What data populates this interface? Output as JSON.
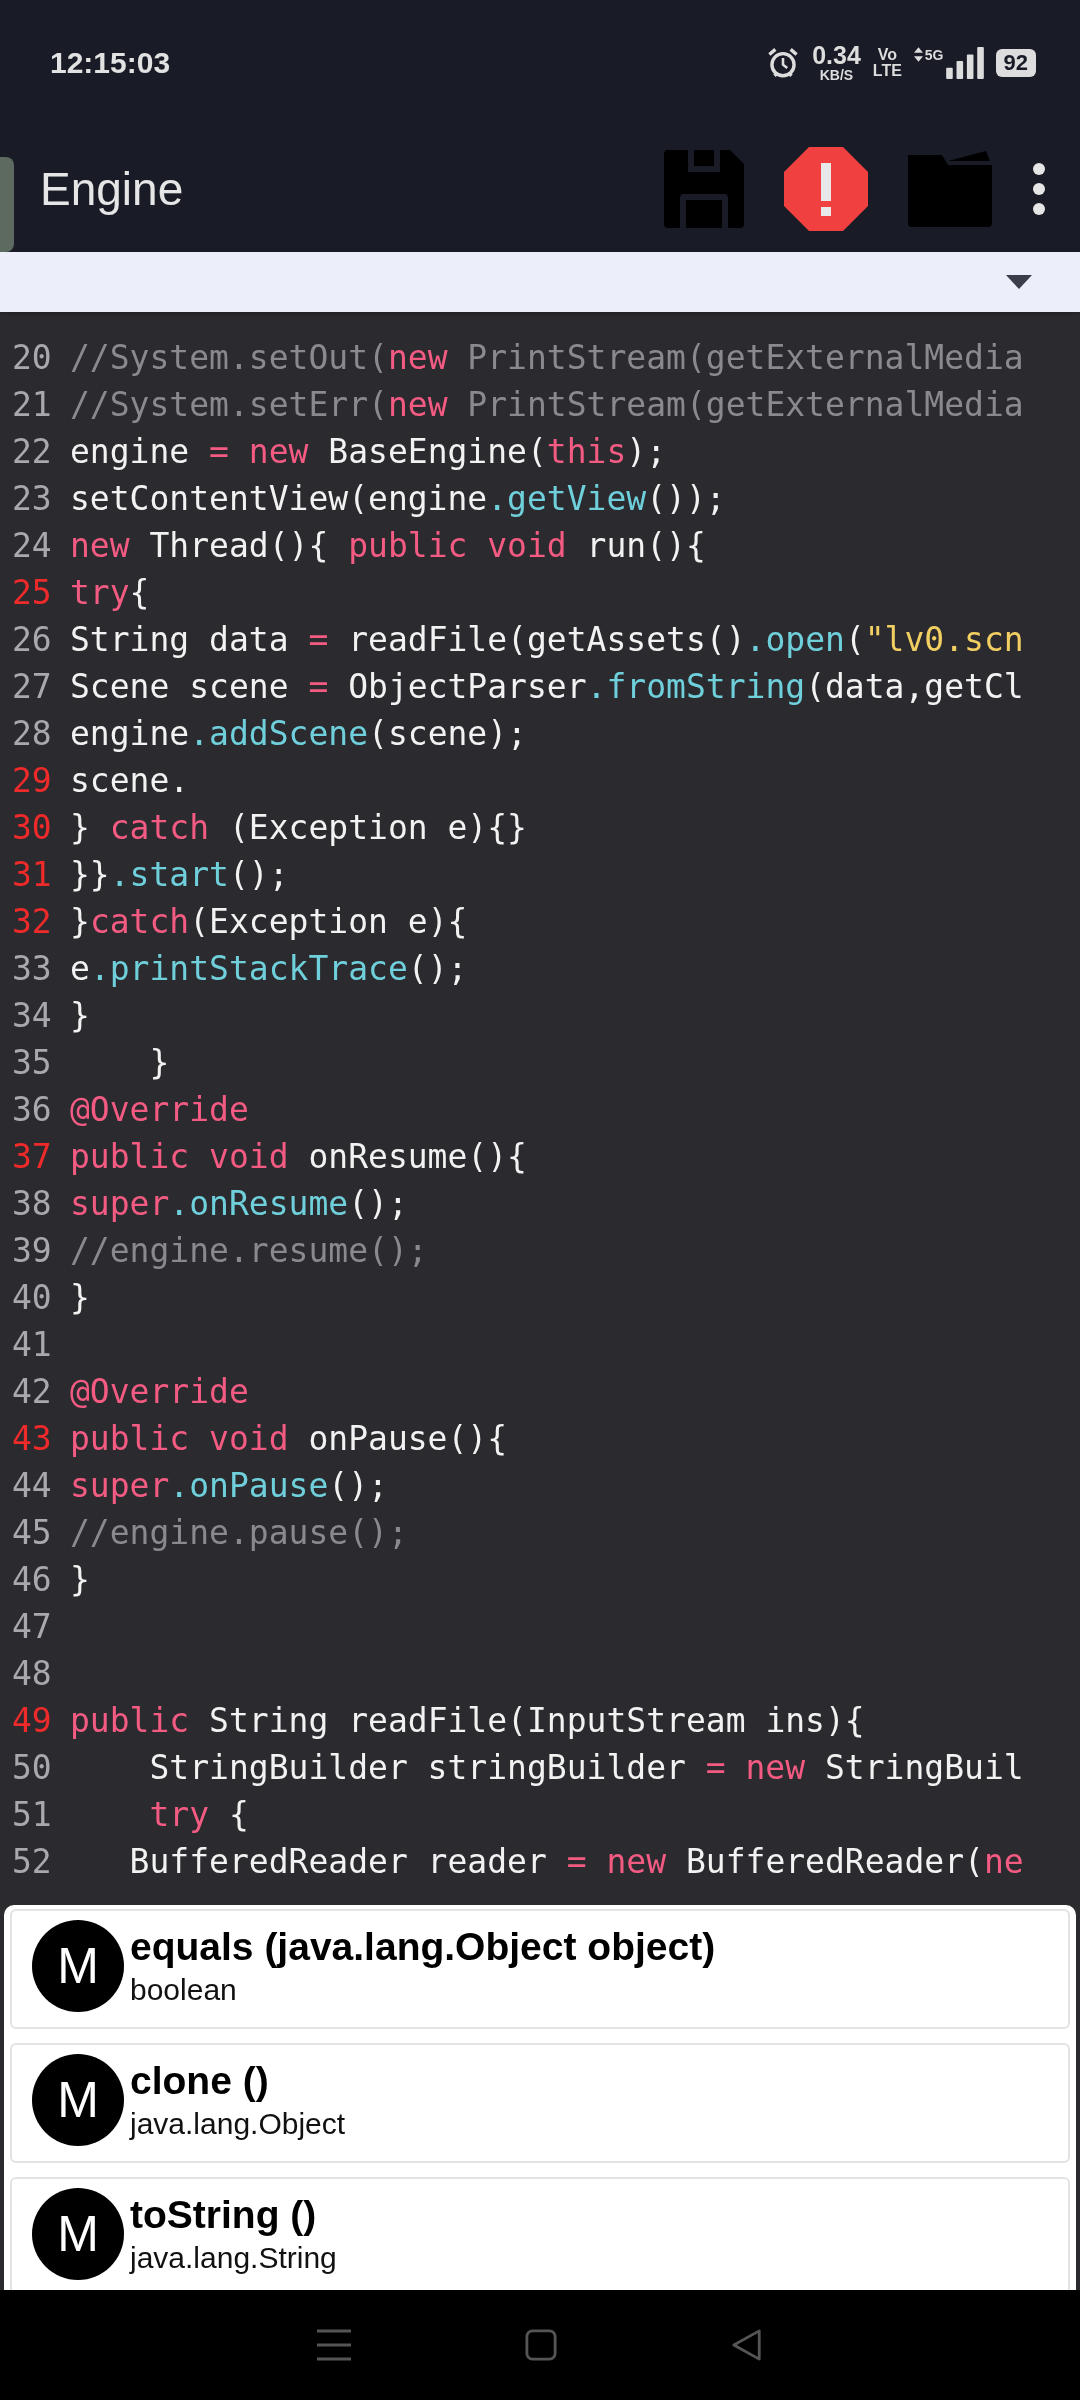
{
  "status_bar": {
    "time": "12:15:03",
    "speed": "0.34",
    "speed_unit": "KB/S",
    "volte_top": "Vo",
    "volte_bottom": "LTE",
    "network": "5G",
    "battery": "92"
  },
  "toolbar": {
    "title": "Engine"
  },
  "code": {
    "lines": [
      {
        "number": "20",
        "marked": false,
        "tokens": [
          {
            "kind": "comment",
            "text": "//System.setOut("
          },
          {
            "kind": "keyword",
            "text": "new"
          },
          {
            "kind": "comment",
            "text": " PrintStream(getExternalMedia"
          }
        ]
      },
      {
        "number": "21",
        "marked": false,
        "tokens": [
          {
            "kind": "comment",
            "text": "//System.setErr("
          },
          {
            "kind": "keyword",
            "text": "new"
          },
          {
            "kind": "comment",
            "text": " PrintStream(getExternalMedia"
          }
        ]
      },
      {
        "number": "22",
        "marked": false,
        "tokens": [
          {
            "kind": "plain",
            "text": "engine "
          },
          {
            "kind": "keyword",
            "text": "= new"
          },
          {
            "kind": "plain",
            "text": " BaseEngine("
          },
          {
            "kind": "keyword",
            "text": "this"
          },
          {
            "kind": "plain",
            "text": ");"
          }
        ]
      },
      {
        "number": "23",
        "marked": false,
        "tokens": [
          {
            "kind": "plain",
            "text": "setContentView(engine"
          },
          {
            "kind": "method",
            "text": ".getView"
          },
          {
            "kind": "plain",
            "text": "());"
          }
        ]
      },
      {
        "number": "24",
        "marked": false,
        "tokens": [
          {
            "kind": "keyword",
            "text": "new"
          },
          {
            "kind": "plain",
            "text": " Thread(){ "
          },
          {
            "kind": "keyword",
            "text": "public void"
          },
          {
            "kind": "plain",
            "text": " run(){"
          }
        ]
      },
      {
        "number": "25",
        "marked": true,
        "tokens": [
          {
            "kind": "keyword",
            "text": "try"
          },
          {
            "kind": "plain",
            "text": "{"
          }
        ]
      },
      {
        "number": "26",
        "marked": false,
        "tokens": [
          {
            "kind": "plain",
            "text": "String data "
          },
          {
            "kind": "keyword",
            "text": "="
          },
          {
            "kind": "plain",
            "text": " readFile(getAssets()"
          },
          {
            "kind": "method",
            "text": ".open"
          },
          {
            "kind": "plain",
            "text": "("
          },
          {
            "kind": "string",
            "text": "\"lv0.scn"
          }
        ]
      },
      {
        "number": "27",
        "marked": false,
        "tokens": [
          {
            "kind": "plain",
            "text": "Scene scene "
          },
          {
            "kind": "keyword",
            "text": "="
          },
          {
            "kind": "plain",
            "text": " ObjectParser"
          },
          {
            "kind": "method",
            "text": ".fromString"
          },
          {
            "kind": "plain",
            "text": "(data,getCl"
          }
        ]
      },
      {
        "number": "28",
        "marked": false,
        "tokens": [
          {
            "kind": "plain",
            "text": "engine"
          },
          {
            "kind": "method",
            "text": ".addScene"
          },
          {
            "kind": "plain",
            "text": "(scene);"
          }
        ]
      },
      {
        "number": "29",
        "marked": true,
        "tokens": [
          {
            "kind": "plain",
            "text": "scene."
          }
        ]
      },
      {
        "number": "30",
        "marked": true,
        "tokens": [
          {
            "kind": "plain",
            "text": "} "
          },
          {
            "kind": "keyword",
            "text": "catch"
          },
          {
            "kind": "plain",
            "text": " (Exception e){}"
          }
        ]
      },
      {
        "number": "31",
        "marked": true,
        "tokens": [
          {
            "kind": "plain",
            "text": "}}"
          },
          {
            "kind": "method",
            "text": ".start"
          },
          {
            "kind": "plain",
            "text": "();"
          }
        ]
      },
      {
        "number": "32",
        "marked": true,
        "tokens": [
          {
            "kind": "plain",
            "text": "}"
          },
          {
            "kind": "keyword",
            "text": "catch"
          },
          {
            "kind": "plain",
            "text": "(Exception e){"
          }
        ]
      },
      {
        "number": "33",
        "marked": false,
        "tokens": [
          {
            "kind": "plain",
            "text": "e"
          },
          {
            "kind": "method",
            "text": ".printStackTrace"
          },
          {
            "kind": "plain",
            "text": "();"
          }
        ]
      },
      {
        "number": "34",
        "marked": false,
        "tokens": [
          {
            "kind": "plain",
            "text": "}"
          }
        ]
      },
      {
        "number": "35",
        "marked": false,
        "tokens": [
          {
            "kind": "plain",
            "text": "    }"
          }
        ]
      },
      {
        "number": "36",
        "marked": false,
        "tokens": [
          {
            "kind": "keyword",
            "text": "@Override"
          }
        ]
      },
      {
        "number": "37",
        "marked": true,
        "tokens": [
          {
            "kind": "keyword",
            "text": "public void"
          },
          {
            "kind": "plain",
            "text": " onResume(){"
          }
        ]
      },
      {
        "number": "38",
        "marked": false,
        "tokens": [
          {
            "kind": "keyword",
            "text": "super"
          },
          {
            "kind": "method",
            "text": ".onResume"
          },
          {
            "kind": "plain",
            "text": "();"
          }
        ]
      },
      {
        "number": "39",
        "marked": false,
        "tokens": [
          {
            "kind": "comment",
            "text": "//engine.resume();"
          }
        ]
      },
      {
        "number": "40",
        "marked": false,
        "tokens": [
          {
            "kind": "plain",
            "text": "}"
          }
        ]
      },
      {
        "number": "41",
        "marked": false
      },
      {
        "number": "42",
        "marked": false,
        "tokens": [
          {
            "kind": "keyword",
            "text": "@Override"
          }
        ]
      },
      {
        "number": "43",
        "marked": true,
        "tokens": [
          {
            "kind": "keyword",
            "text": "public void"
          },
          {
            "kind": "plain",
            "text": " onPause(){"
          }
        ]
      },
      {
        "number": "44",
        "marked": false,
        "tokens": [
          {
            "kind": "keyword",
            "text": "super"
          },
          {
            "kind": "method",
            "text": ".onPause"
          },
          {
            "kind": "plain",
            "text": "();"
          }
        ]
      },
      {
        "number": "45",
        "marked": false,
        "tokens": [
          {
            "kind": "comment",
            "text": "//engine.pause();"
          }
        ]
      },
      {
        "number": "46",
        "marked": false,
        "tokens": [
          {
            "kind": "plain",
            "text": "}"
          }
        ]
      },
      {
        "number": "47",
        "marked": false
      },
      {
        "number": "48",
        "marked": false
      },
      {
        "number": "49",
        "marked": true,
        "tokens": [
          {
            "kind": "keyword",
            "text": "public"
          },
          {
            "kind": "plain",
            "text": " String readFile(InputStream ins){"
          }
        ]
      },
      {
        "number": "50",
        "marked": false,
        "tokens": [
          {
            "kind": "plain",
            "text": "    StringBuilder stringBuilder "
          },
          {
            "kind": "keyword",
            "text": "= new"
          },
          {
            "kind": "plain",
            "text": " StringBuil"
          }
        ]
      },
      {
        "number": "51",
        "marked": false,
        "tokens": [
          {
            "kind": "keyword",
            "text": "    try"
          },
          {
            "kind": "plain",
            "text": " {"
          }
        ]
      },
      {
        "number": "52",
        "marked": false,
        "tokens": [
          {
            "kind": "plain",
            "text": "   BufferedReader reader "
          },
          {
            "kind": "keyword",
            "text": "= new"
          },
          {
            "kind": "plain",
            "text": " BufferedReader("
          },
          {
            "kind": "keyword",
            "text": "ne"
          }
        ]
      }
    ]
  },
  "suggestions": [
    {
      "icon_letter": "M",
      "title": "equals (java.lang.Object object)",
      "type": "boolean"
    },
    {
      "icon_letter": "M",
      "title": "clone ()",
      "type": "java.lang.Object"
    },
    {
      "icon_letter": "M",
      "title": "toString ()",
      "type": "java.lang.String"
    }
  ]
}
